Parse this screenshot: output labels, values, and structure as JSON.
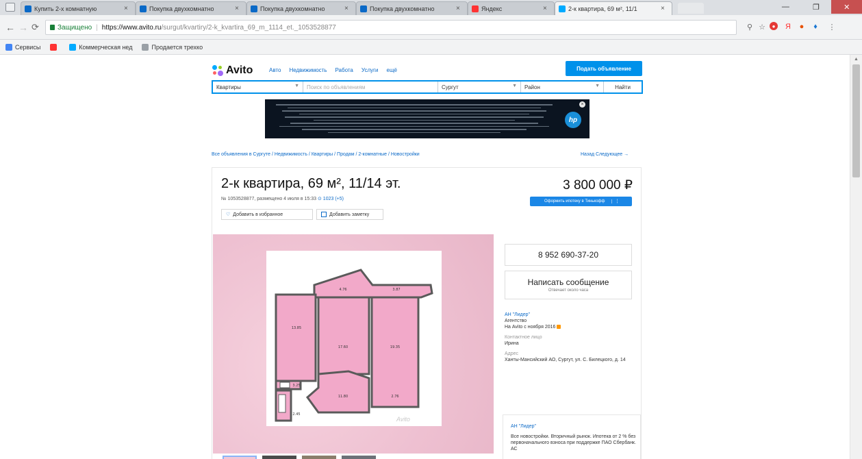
{
  "browser": {
    "tabs": [
      {
        "title": "Купить 2-х комнатную",
        "favicon_color": "#0a69c7",
        "active": false
      },
      {
        "title": "Покупка двухкомнатно",
        "favicon_color": "#0a69c7",
        "active": false
      },
      {
        "title": "Покупка двухкомнатно",
        "favicon_color": "#0a69c7",
        "active": false
      },
      {
        "title": "Покупка двухкомнатно",
        "favicon_color": "#0a69c7",
        "active": false
      },
      {
        "title": "Яндекс",
        "favicon_color": "#ff3333",
        "active": false
      },
      {
        "title": "2-к квартира, 69 м², 11/1",
        "favicon_color": "#00aaff",
        "active": true
      }
    ],
    "tab_close_glyph": "×",
    "window_controls": {
      "minimize": "—",
      "maximize": "❐",
      "close": "✕"
    },
    "address": {
      "secure_label": "Защищено",
      "url_host": "https://www.avito.ru",
      "url_path": "/surgut/kvartiry/2-k_kvartira_69_m_1114_et._1053528877"
    },
    "bookmarks": [
      {
        "label": "Сервисы",
        "icon_color": "#4285f4"
      },
      {
        "label": "",
        "icon_color": "#ff3333"
      },
      {
        "label": "Коммерческая нед",
        "icon_color": "#00aaff"
      },
      {
        "label": "Продается трехко",
        "icon_color": "#9aa0a6"
      }
    ]
  },
  "header": {
    "logo": "Avito",
    "nav": [
      "Авто",
      "Недвижимость",
      "Работа",
      "Услуги",
      "ещё"
    ],
    "post_button": "Подать объявление"
  },
  "search": {
    "category": "Квартиры",
    "query_placeholder": "Поиск по объявлениям",
    "city": "Сургут",
    "district": "Район",
    "submit": "Найти"
  },
  "breadcrumb": "Все объявления в Сургуте / Недвижимость / Квартиры / Продам / 2-комнатные / Новостройки",
  "prev_next": "Назад  Следующее →",
  "listing": {
    "title": "2-к квартира, 69 м², 11/14 эт.",
    "meta": "№ 1053528877, размещено 4 июля в 15:33",
    "views": "1023 (+5)",
    "favorite_button": "Добавить в избранное",
    "note_button": "Добавить заметку",
    "price": "3 800 000 ₽",
    "mortgage_button": "Оформить ипотеку в Тинькофф",
    "room_labels": [
      "4.76",
      "3.87",
      "13.85",
      "17.60",
      "19.35",
      "11.80",
      "2.76",
      "3.25",
      "2.45"
    ],
    "watermark": "Avito"
  },
  "contact": {
    "phone": "8 952 690-37-20",
    "message_button": "Написать сообщение",
    "reply_time": "Отвечает около часа",
    "seller_name": "АН \"Лидер\"",
    "seller_type": "Агентство",
    "on_avito_since": "На Avito с ноября 2016",
    "contact_label": "Контактное лицо",
    "contact_person": "Ирина",
    "address_label": "Адрес",
    "address": "Ханты-Мансийский АО, Сургут, ул. С. Билецкого, д. 14"
  },
  "promo": {
    "title": "АН \"Лидер\"",
    "text": "Все новостройки. Вторичный рынок. Ипотека от 2 % без первоначального взноса при поддержке ПАО Сбербанк. АС"
  },
  "colors": {
    "accent": "#0091ea",
    "link": "#0a69c7",
    "plan_fill": "#f2a9c9",
    "plan_wall": "#5a5a5a"
  }
}
